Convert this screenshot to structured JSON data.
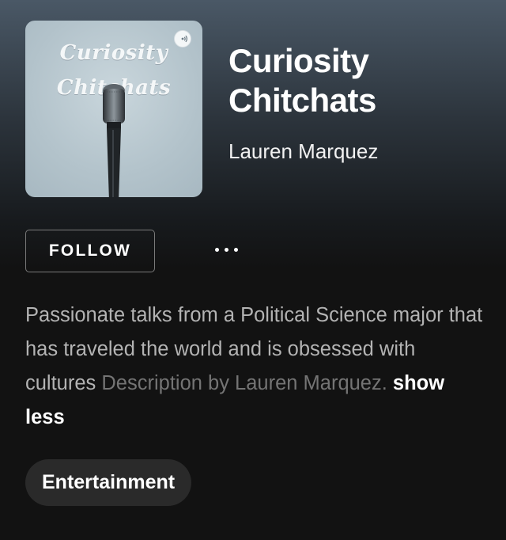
{
  "podcast": {
    "cover": {
      "title_line1": "Curiosity",
      "title_line2": "Chitchats",
      "badge_icon": "podcast-icon"
    },
    "title": "Curiosity Chitchats",
    "author": "Lauren Marquez"
  },
  "actions": {
    "follow_label": "FOLLOW",
    "more_icon": "more-options-icon"
  },
  "description": {
    "text": "Passionate talks from a Political Science major that has traveled the world and is obsessed with cultures",
    "attribution": "Description by Lauren Marquez.",
    "toggle_label": "show less"
  },
  "category": {
    "label": "Entertainment"
  },
  "colors": {
    "background_top": "#4a5866",
    "background": "#121212",
    "text_primary": "#ffffff",
    "text_secondary": "#b3b3b3",
    "text_muted": "#747474",
    "chip_bg": "#2a2a2a"
  }
}
